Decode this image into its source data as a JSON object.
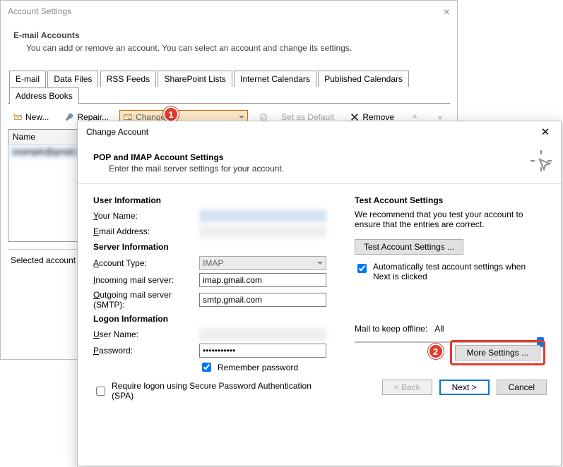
{
  "backWindow": {
    "title": "Account Settings",
    "heading": "E-mail Accounts",
    "subheading": "You can add or remove an account. You can select an account and change its settings."
  },
  "tabs": [
    "E-mail",
    "Data Files",
    "RSS Feeds",
    "SharePoint Lists",
    "Internet Calendars",
    "Published Calendars",
    "Address Books"
  ],
  "toolbar": {
    "new": "New...",
    "repair": "Repair...",
    "change": "Change...",
    "setdefault": "Set as Default",
    "remove": "Remove"
  },
  "list": {
    "header": "Name",
    "row": "example@gmail.com"
  },
  "selectedStatus": "Selected account de",
  "badge1": "1",
  "dialog": {
    "title": "Change Account",
    "heading": "POP and IMAP Account Settings",
    "subheading": "Enter the mail server settings for your account.",
    "sections": {
      "user": "User Information",
      "server": "Server Information",
      "logon": "Logon Information",
      "test": "Test Account Settings"
    },
    "labels": {
      "yourName": "Your Name:",
      "email": "Email Address:",
      "acctType": "Account Type:",
      "incoming": "Incoming mail server:",
      "outgoing": "Outgoing mail server (SMTP):",
      "userName": "User Name:",
      "password": "Password:",
      "remember": "Remember password",
      "spa": "Require logon using Secure Password Authentication (SPA)",
      "testDesc": "We recommend that you test your account to ensure that the entries are correct.",
      "testBtn": "Test Account Settings ...",
      "autoTest": "Automatically test account settings when Next is clicked",
      "mailKeep": "Mail to keep offline:",
      "mailKeepVal": "All",
      "moreBtn": "More Settings ...",
      "back": "< Back",
      "next": "Next >",
      "cancel": "Cancel"
    },
    "values": {
      "yourName": "",
      "email": "",
      "acctType": "IMAP",
      "incoming": "imap.gmail.com",
      "outgoing": "smtp.gmail.com",
      "userName": "",
      "password": "***********"
    },
    "badge2": "2"
  }
}
